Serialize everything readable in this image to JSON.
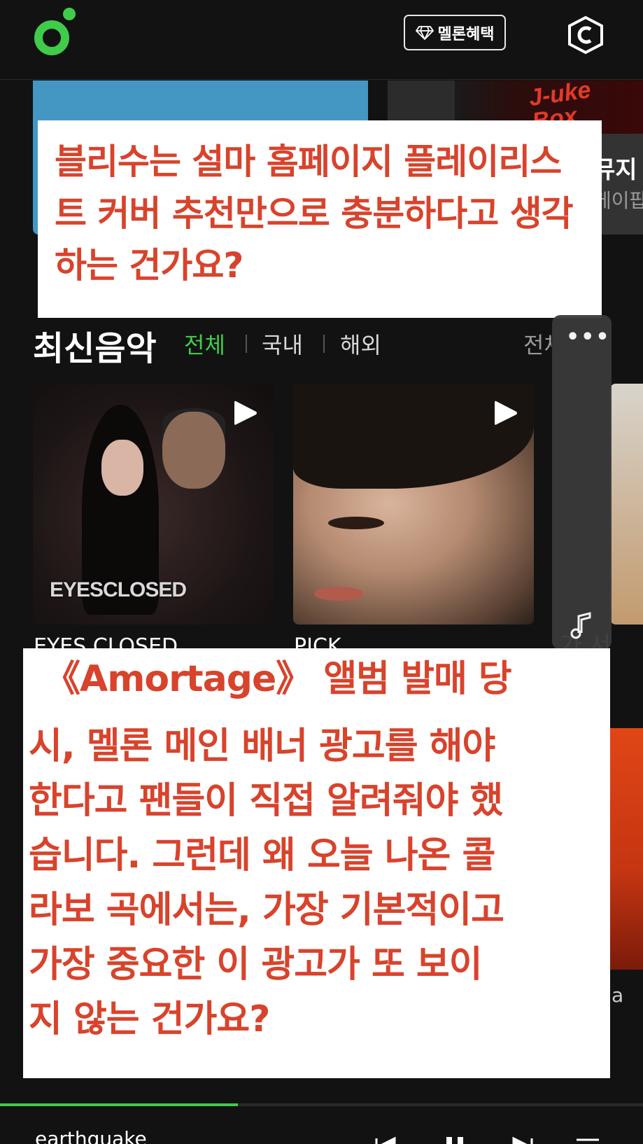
{
  "header": {
    "benefit_label": "멜론혜택"
  },
  "banner": {
    "right_art_text": "J-uke\nBox",
    "right_title": "뮤지",
    "right_sub": "케이팝"
  },
  "overlay_top": {
    "text": "블리수는 설마 홈페이지 플레이리스트 커버 추천만으로 충분하다고 생각하는 건가요?"
  },
  "section": {
    "title": "최신음악",
    "filters": [
      "전체",
      "국내",
      "해외"
    ],
    "see_all": "전체"
  },
  "albums": [
    {
      "cover_text": "EYESCLOSED",
      "caption": "EYES CLOSED"
    },
    {
      "cover_text": "",
      "caption": "PICK"
    },
    {
      "caption": "가 서"
    }
  ],
  "overlay_bottom": {
    "lines": [
      "《Amortage》 앨범 발매 당",
      "시, 멜론 메인 배너 광고를 해야",
      "한다고 팬들이 직접 알려줘야 했",
      "습니다. 그런데 왜 오늘 나온 콜",
      "라보 곡에서는, 가장 기본적이고",
      "가장 중요한 이 광고가 또 보이",
      "지 않는 건가요?"
    ]
  },
  "side_letter": "a",
  "player": {
    "now_playing": "earthquake",
    "progress": 0.37
  },
  "colors": {
    "accent": "#3fcc4a",
    "overlay_text": "#d8432c",
    "banner_blue": "#4397c2"
  },
  "icons": [
    "melon-logo-icon",
    "diamond-icon",
    "hexagon-c-icon",
    "play-icon",
    "more-dots-icon",
    "music-note-icon",
    "prev-icon",
    "pause-icon",
    "next-icon",
    "playlist-icon"
  ]
}
